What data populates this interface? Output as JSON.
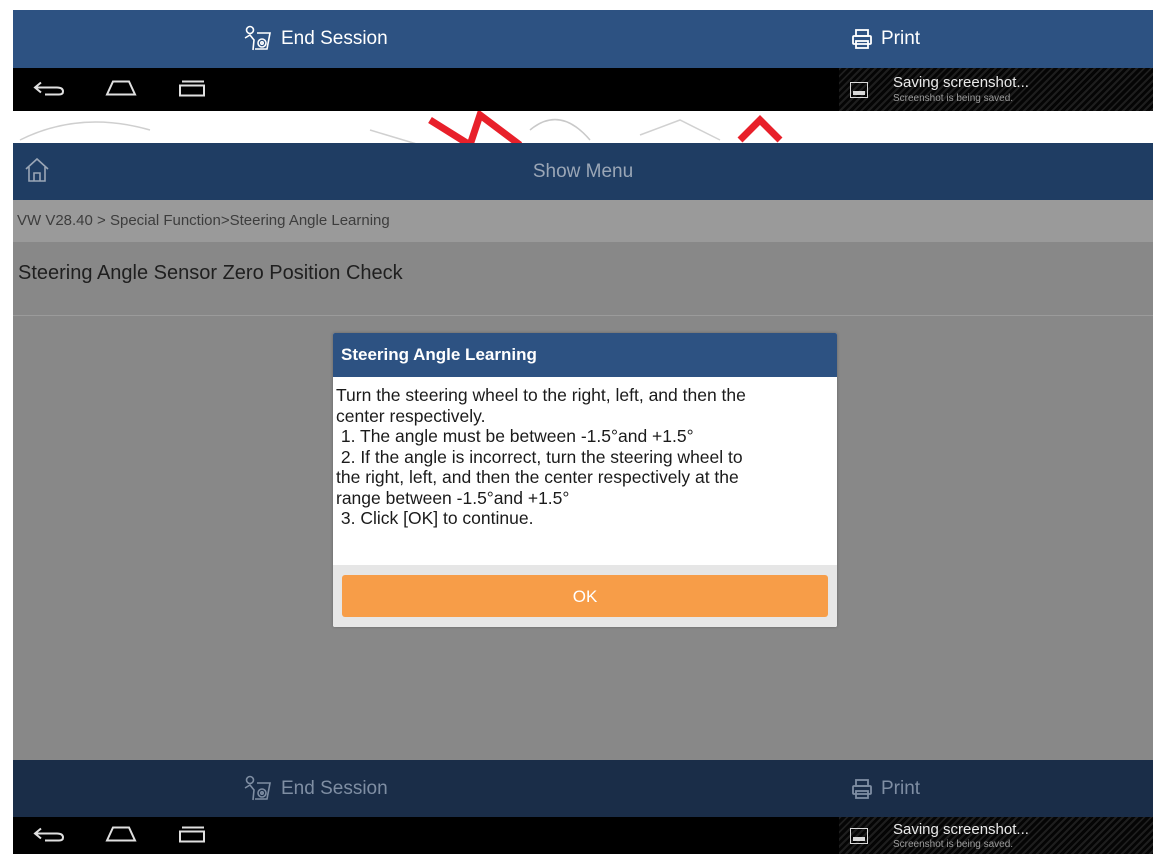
{
  "action_bar": {
    "end_session_label": "End Session",
    "print_label": "Print",
    "bg_color": "#2d5282"
  },
  "notification": {
    "title": "Saving screenshot...",
    "subtitle": "Screenshot is being saved."
  },
  "app_bar": {
    "title": "Show Menu"
  },
  "breadcrumb": "VW V28.40 > Special Function>Steering Angle Learning",
  "function_title": "Steering Angle Sensor Zero Position Check",
  "dialog": {
    "title": "Steering Angle Learning",
    "lines": [
      "Turn the steering wheel to the right, left, and then the",
      "center respectively.",
      " 1. The angle must be between -1.5°and +1.5°",
      " 2. If the angle is incorrect, turn the steering wheel to",
      "the right, left, and then the center respectively at the",
      "range between -1.5°and +1.5°",
      " 3. Click [OK] to continue."
    ],
    "ok_label": "OK",
    "ok_color": "#f79d48"
  }
}
